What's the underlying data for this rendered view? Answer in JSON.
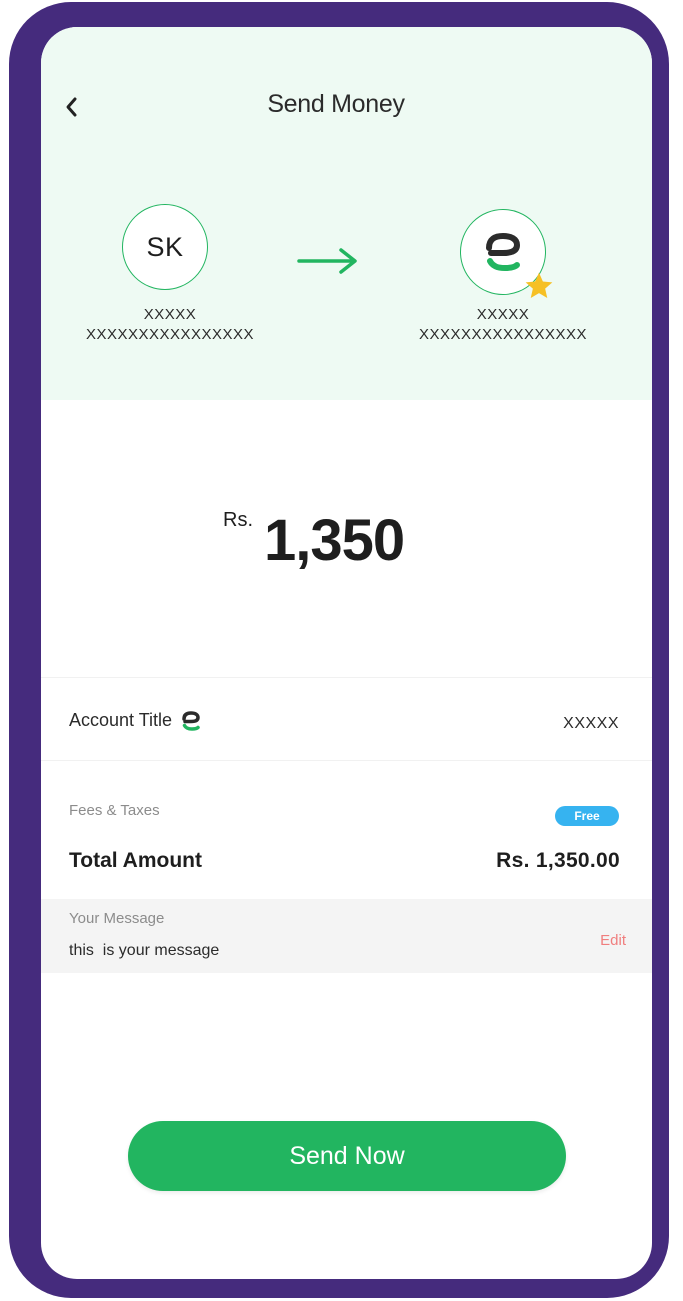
{
  "header": {
    "title": "Send Money",
    "back_icon": "chevron-left-icon"
  },
  "sender": {
    "initials": "SK",
    "name": "XXXXX",
    "account": "XXXXXXXXXXXXXXXX"
  },
  "receiver": {
    "avatar_icon": "easypaisa-logo-icon",
    "badge_icon": "star-icon",
    "name": "XXXXX",
    "account": "XXXXXXXXXXXXXXXX"
  },
  "transfer_arrow_icon": "arrow-right-icon",
  "amount": {
    "currency": "Rs.",
    "value": "1,350"
  },
  "account_title": {
    "label": "Account Title",
    "value": "XXXXX",
    "icon": "easypaisa-logo-icon"
  },
  "fees": {
    "label": "Fees & Taxes",
    "badge": "Free"
  },
  "total": {
    "label": "Total Amount",
    "value": "Rs. 1,350.00"
  },
  "message": {
    "label": "Your Message",
    "text": "this  is your message",
    "edit_label": "Edit"
  },
  "send_button": {
    "label": "Send Now"
  },
  "colors": {
    "frame": "#452b7d",
    "header_bg": "#eefaf3",
    "brand_green": "#22b560",
    "free_badge": "#36b3f0",
    "edit_link": "#f07e7e",
    "star": "#f6c025"
  }
}
